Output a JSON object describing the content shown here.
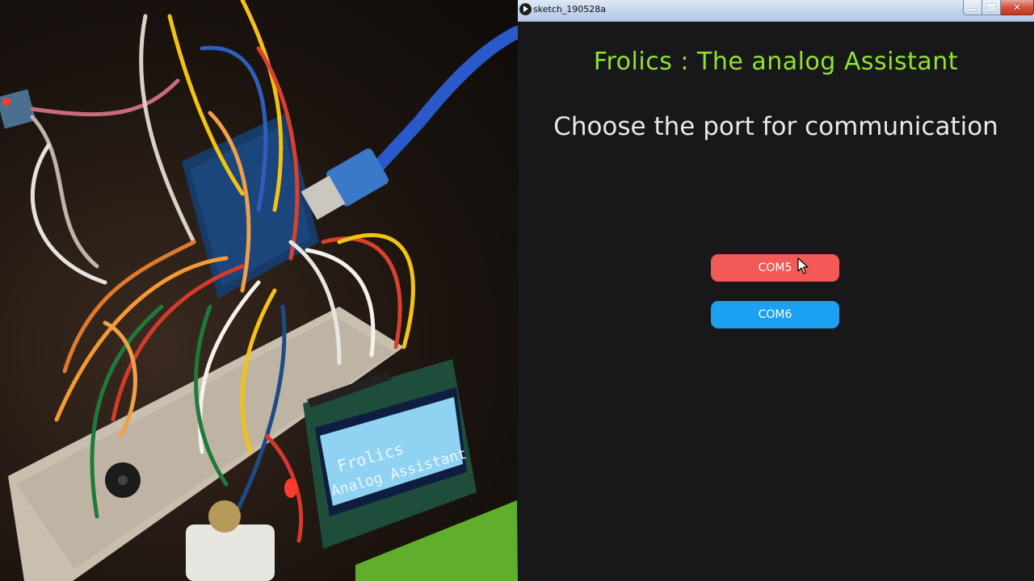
{
  "window": {
    "title": "sketch_190528a",
    "controls": [
      "minimize-icon",
      "maximize-icon",
      "close-icon"
    ]
  },
  "app": {
    "title": "Frolics : The analog Assistant",
    "subtitle": "Choose the port for communication",
    "title_color": "#8fe32f",
    "ports": [
      {
        "label": "COM5",
        "color": "#f15a57",
        "hovered": true
      },
      {
        "label": "COM6",
        "color": "#1ba0f2",
        "hovered": false
      }
    ]
  },
  "photo": {
    "lcd_text": [
      "Frolics",
      "Analog Assistant"
    ],
    "lcd_color": "#8fd2f2"
  }
}
